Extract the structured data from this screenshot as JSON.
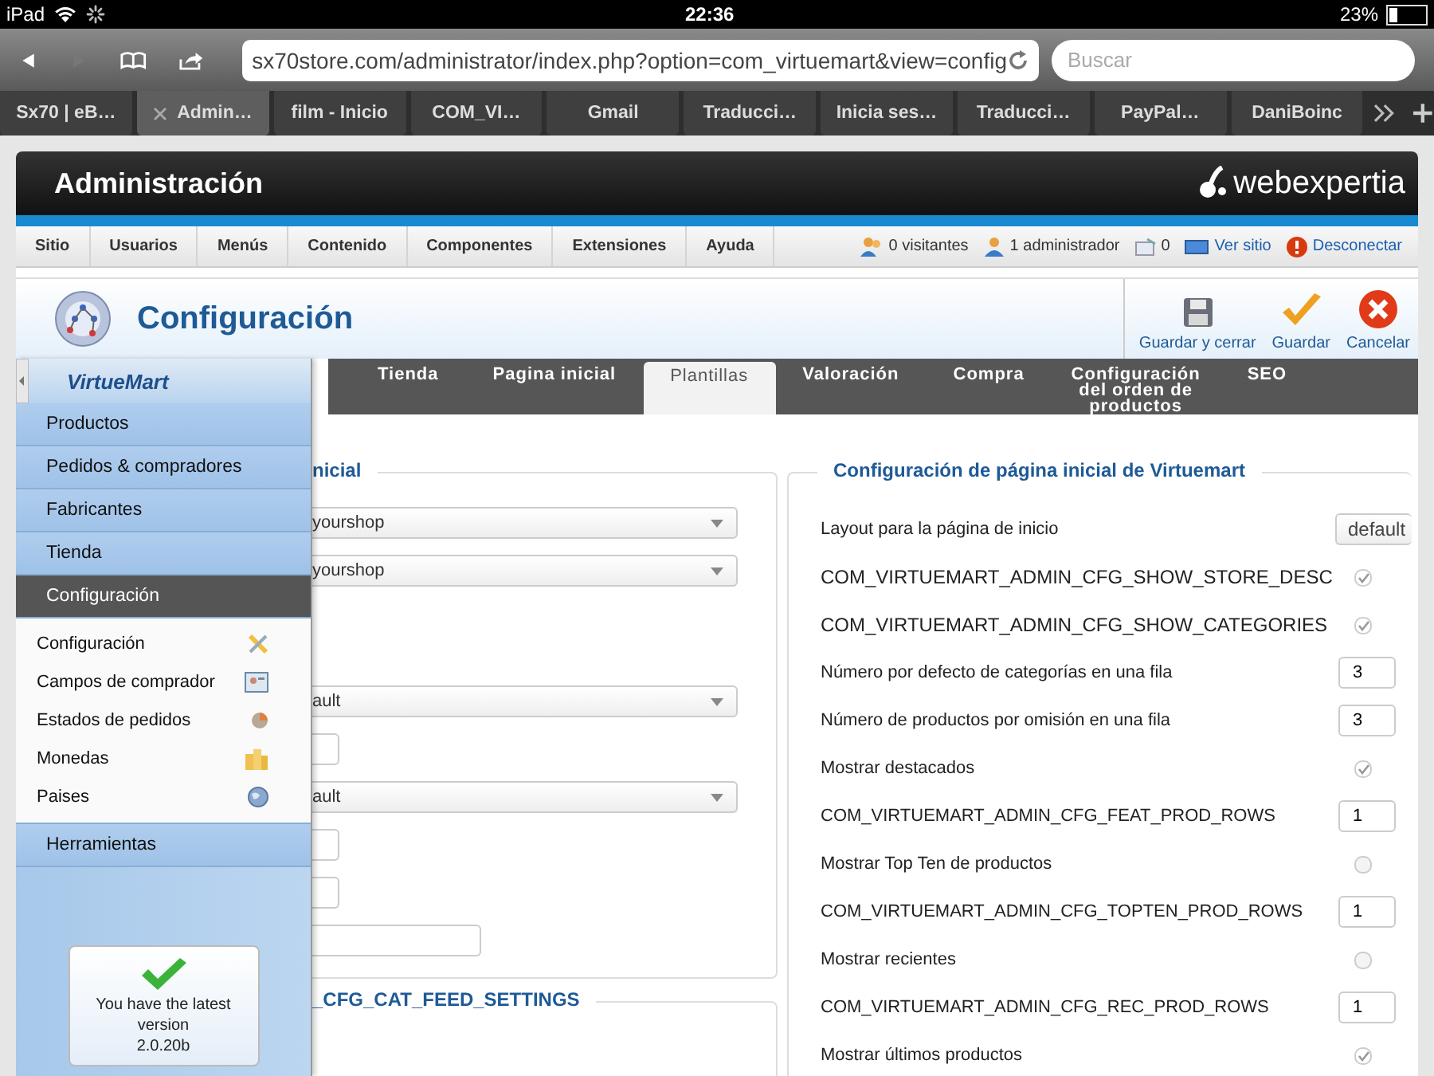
{
  "status_bar": {
    "device": "iPad",
    "time": "22:36",
    "battery": "23%"
  },
  "browser": {
    "url": "sx70store.com/administrator/index.php?option=com_virtuemart&view=config",
    "search_placeholder": "Buscar",
    "tabs": [
      {
        "label": "Sx70 | eB…",
        "selected": false
      },
      {
        "label": "Admin…",
        "selected": true
      },
      {
        "label": "film - Inicio",
        "selected": false
      },
      {
        "label": "COM_VI…",
        "selected": false
      },
      {
        "label": "Gmail",
        "selected": false
      },
      {
        "label": "Traducci…",
        "selected": false
      },
      {
        "label": "Inicia ses…",
        "selected": false
      },
      {
        "label": "Traducci…",
        "selected": false
      },
      {
        "label": "PayPal…",
        "selected": false
      },
      {
        "label": "DaniBoinc",
        "selected": false
      }
    ]
  },
  "admin": {
    "title": "Administración",
    "brand": "webexpertia",
    "menu": [
      "Sitio",
      "Usuarios",
      "Menús",
      "Contenido",
      "Componentes",
      "Extensiones",
      "Ayuda"
    ],
    "status": [
      {
        "kind": "visitors",
        "label": "0 visitantes"
      },
      {
        "kind": "admins",
        "label": "1 administrador"
      },
      {
        "kind": "messages",
        "label": "0"
      },
      {
        "kind": "site",
        "label": "Ver sitio"
      },
      {
        "kind": "logout",
        "label": "Desconectar"
      }
    ]
  },
  "toolbar": {
    "title": "Configuración",
    "buttons": [
      {
        "kind": "save_close",
        "label": "Guardar y cerrar"
      },
      {
        "kind": "save",
        "label": "Guardar"
      },
      {
        "kind": "cancel",
        "label": "Cancelar"
      }
    ]
  },
  "sidebar": {
    "logo": "VirtueMart",
    "sections": [
      {
        "label": "Productos",
        "selected": false
      },
      {
        "label": "Pedidos & compradores",
        "selected": false
      },
      {
        "label": "Fabricantes",
        "selected": false
      },
      {
        "label": "Tienda",
        "selected": false
      },
      {
        "label": "Configuración",
        "selected": true,
        "children": [
          {
            "label": "Configuración",
            "kind": "tools"
          },
          {
            "label": "Campos de comprador",
            "kind": "card"
          },
          {
            "label": "Estados de pedidos",
            "kind": "pie"
          },
          {
            "label": "Monedas",
            "kind": "coins"
          },
          {
            "label": "Paises",
            "kind": "globe"
          }
        ]
      },
      {
        "label": "Herramientas",
        "selected": false
      }
    ],
    "version_box": {
      "message": "You have the latest version",
      "version": "2.0.20b"
    }
  },
  "config": {
    "tabs": [
      {
        "label": "Tienda",
        "selected": false
      },
      {
        "label": "Pagina inicial",
        "selected": false
      },
      {
        "label": "Plantillas",
        "selected": true
      },
      {
        "label": "Valoración",
        "selected": false
      },
      {
        "label": "Compra",
        "selected": false
      },
      {
        "label": "Configuración del orden de productos",
        "selected": false
      },
      {
        "label": "SEO",
        "selected": false
      }
    ],
    "left_fieldset": {
      "legend": "nicial",
      "fields": [
        {
          "kind": "select",
          "value": "yourshop"
        },
        {
          "kind": "select",
          "value": "yourshop"
        },
        {
          "kind": "select",
          "value": "ault"
        },
        {
          "kind": "short_input"
        },
        {
          "kind": "select",
          "value": "ault"
        },
        {
          "kind": "short_input"
        },
        {
          "kind": "short_input"
        },
        {
          "kind": "input"
        }
      ]
    },
    "second_fieldset": {
      "legend": "_CFG_CAT_FEED_SETTINGS"
    },
    "right_fieldset": {
      "legend": "Configuración de página inicial de Virtuemart",
      "rows": [
        {
          "label": "Layout para la página de inicio",
          "kind": "select",
          "value": "default"
        },
        {
          "label": "COM_VIRTUEMART_ADMIN_CFG_SHOW_STORE_DESC",
          "kind": "checkbox",
          "checked": true
        },
        {
          "label": "COM_VIRTUEMART_ADMIN_CFG_SHOW_CATEGORIES",
          "kind": "checkbox",
          "checked": true
        },
        {
          "label": "Número por defecto de categorías en una fila",
          "kind": "input",
          "value": "3"
        },
        {
          "label": "Número de productos por omisión en una fila",
          "kind": "input",
          "value": "3"
        },
        {
          "label": "Mostrar destacados",
          "kind": "checkbox",
          "checked": true
        },
        {
          "label": "COM_VIRTUEMART_ADMIN_CFG_FEAT_PROD_ROWS",
          "kind": "input",
          "value": "1"
        },
        {
          "label": "Mostrar Top Ten de productos",
          "kind": "checkbox",
          "checked": false
        },
        {
          "label": "COM_VIRTUEMART_ADMIN_CFG_TOPTEN_PROD_ROWS",
          "kind": "input",
          "value": "1"
        },
        {
          "label": "Mostrar recientes",
          "kind": "checkbox",
          "checked": false
        },
        {
          "label": "COM_VIRTUEMART_ADMIN_CFG_REC_PROD_ROWS",
          "kind": "input",
          "value": "1"
        },
        {
          "label": "Mostrar últimos productos",
          "kind": "checkbox",
          "checked": true
        }
      ]
    }
  }
}
